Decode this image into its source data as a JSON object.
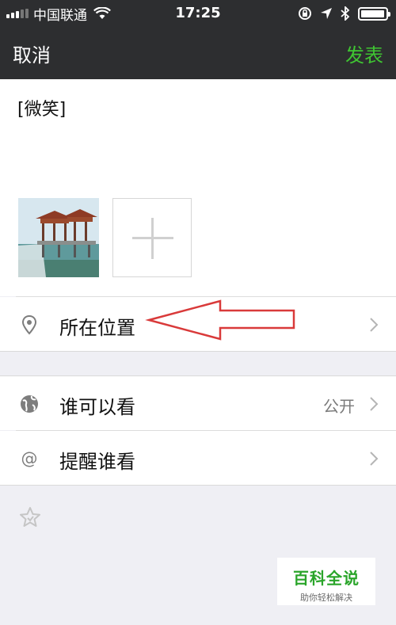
{
  "status_bar": {
    "carrier": "中国联通",
    "time": "17:25",
    "battery_level": 0.95
  },
  "nav": {
    "cancel_label": "取消",
    "post_label": "发表"
  },
  "compose": {
    "text": "[微笑]"
  },
  "options": [
    {
      "label": "所在位置",
      "value": "",
      "icon": "location-pin-icon"
    },
    {
      "label": "谁可以看",
      "value": "公开",
      "icon": "globe-icon"
    },
    {
      "label": "提醒谁看",
      "value": "",
      "icon": "at-icon"
    }
  ],
  "watermark": {
    "title": "百科全说",
    "subtitle": "助你轻松解决"
  },
  "colors": {
    "nav_bg": "#2d2e30",
    "accent_green": "#3fc532",
    "annotation_arrow": "#d93a3a"
  }
}
